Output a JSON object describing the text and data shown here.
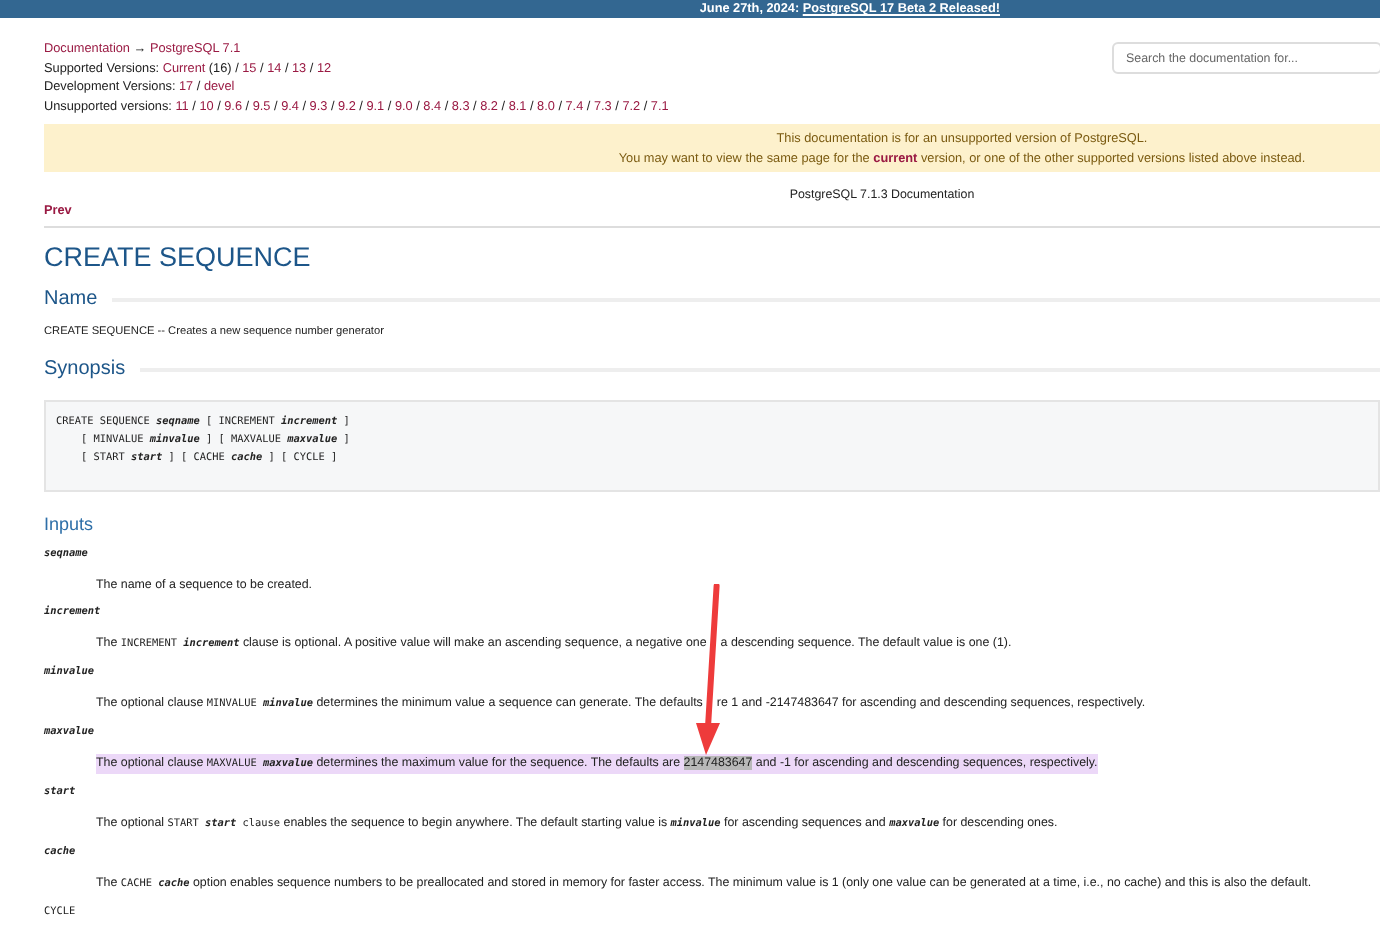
{
  "banner": [
    {
      "kind": "text",
      "text": "June 27th, 2024: "
    },
    {
      "kind": "link",
      "text": "PostgreSQL 17 Beta 2 Released!"
    }
  ],
  "search": {
    "placeholder": "Search the documentation for..."
  },
  "version_lines": [
    [
      {
        "kind": "link",
        "text": "Documentation"
      },
      {
        "kind": "text",
        "text": " → "
      },
      {
        "kind": "link",
        "text": "PostgreSQL 7.1"
      }
    ],
    [
      {
        "kind": "text",
        "text": "Supported Versions: "
      },
      {
        "kind": "link",
        "text": "Current"
      },
      {
        "kind": "text",
        "text": " (16) / "
      },
      {
        "kind": "link",
        "text": "15"
      },
      {
        "kind": "text",
        "text": " / "
      },
      {
        "kind": "link",
        "text": "14"
      },
      {
        "kind": "text",
        "text": " / "
      },
      {
        "kind": "link",
        "text": "13"
      },
      {
        "kind": "text",
        "text": " / "
      },
      {
        "kind": "link",
        "text": "12"
      }
    ],
    [
      {
        "kind": "text",
        "text": "Development Versions: "
      },
      {
        "kind": "link",
        "text": "17"
      },
      {
        "kind": "text",
        "text": " / "
      },
      {
        "kind": "link",
        "text": "devel"
      }
    ],
    [
      {
        "kind": "text",
        "text": "Unsupported versions: "
      },
      {
        "kind": "link",
        "text": "11"
      },
      {
        "kind": "text",
        "text": " / "
      },
      {
        "kind": "link",
        "text": "10"
      },
      {
        "kind": "text",
        "text": " / "
      },
      {
        "kind": "link",
        "text": "9.6"
      },
      {
        "kind": "text",
        "text": " / "
      },
      {
        "kind": "link",
        "text": "9.5"
      },
      {
        "kind": "text",
        "text": " / "
      },
      {
        "kind": "link",
        "text": "9.4"
      },
      {
        "kind": "text",
        "text": " / "
      },
      {
        "kind": "link",
        "text": "9.3"
      },
      {
        "kind": "text",
        "text": " / "
      },
      {
        "kind": "link",
        "text": "9.2"
      },
      {
        "kind": "text",
        "text": " / "
      },
      {
        "kind": "link",
        "text": "9.1"
      },
      {
        "kind": "text",
        "text": " / "
      },
      {
        "kind": "link",
        "text": "9.0"
      },
      {
        "kind": "text",
        "text": " / "
      },
      {
        "kind": "link",
        "text": "8.4"
      },
      {
        "kind": "text",
        "text": " / "
      },
      {
        "kind": "link",
        "text": "8.3"
      },
      {
        "kind": "text",
        "text": " / "
      },
      {
        "kind": "link",
        "text": "8.2"
      },
      {
        "kind": "text",
        "text": " / "
      },
      {
        "kind": "link",
        "text": "8.1"
      },
      {
        "kind": "text",
        "text": " / "
      },
      {
        "kind": "link",
        "text": "8.0"
      },
      {
        "kind": "text",
        "text": " / "
      },
      {
        "kind": "link",
        "text": "7.4"
      },
      {
        "kind": "text",
        "text": " / "
      },
      {
        "kind": "link",
        "text": "7.3"
      },
      {
        "kind": "text",
        "text": " / "
      },
      {
        "kind": "link",
        "text": "7.2"
      },
      {
        "kind": "text",
        "text": " / "
      },
      {
        "kind": "link",
        "text": "7.1"
      }
    ]
  ],
  "notice": [
    [
      {
        "kind": "text",
        "text": "This documentation is for an unsupported version of PostgreSQL."
      }
    ],
    [
      {
        "kind": "text",
        "text": "You may want to view the same page for the "
      },
      {
        "kind": "strong_link",
        "text": "current"
      },
      {
        "kind": "text",
        "text": " version, or one of the other supported versions listed above instead."
      }
    ]
  ],
  "nav_header": {
    "title": "PostgreSQL 7.1.3 Documentation",
    "prev": "Prev"
  },
  "title": "CREATE SEQUENCE",
  "name_section": {
    "heading": "Name",
    "text": "CREATE SEQUENCE  --  Creates a new sequence number generator"
  },
  "synopsis": {
    "heading": "Synopsis",
    "lines": [
      [
        {
          "kind": "code",
          "text": "CREATE SEQUENCE "
        },
        {
          "kind": "param",
          "text": "seqname"
        },
        {
          "kind": "code",
          "text": " [ INCREMENT "
        },
        {
          "kind": "param",
          "text": "increment"
        },
        {
          "kind": "code",
          "text": " ]"
        }
      ],
      [
        {
          "kind": "code",
          "text": "    [ MINVALUE "
        },
        {
          "kind": "param",
          "text": "minvalue"
        },
        {
          "kind": "code",
          "text": " ] [ MAXVALUE "
        },
        {
          "kind": "param",
          "text": "maxvalue"
        },
        {
          "kind": "code",
          "text": " ]"
        }
      ],
      [
        {
          "kind": "code",
          "text": "    [ START "
        },
        {
          "kind": "param",
          "text": "start"
        },
        {
          "kind": "code",
          "text": " ] [ CACHE "
        },
        {
          "kind": "param",
          "text": "cache"
        },
        {
          "kind": "code",
          "text": " ] [ CYCLE ]"
        }
      ]
    ]
  },
  "inputs": {
    "heading": "Inputs",
    "entries": [
      {
        "term": {
          "kind": "param",
          "text": "seqname"
        },
        "highlighted": false,
        "description": [
          {
            "kind": "text",
            "text": "The name of a sequence to be created."
          }
        ]
      },
      {
        "term": {
          "kind": "param",
          "text": "increment"
        },
        "highlighted": false,
        "description": [
          {
            "kind": "text",
            "text": "The "
          },
          {
            "kind": "code",
            "text": "INCREMENT "
          },
          {
            "kind": "param",
            "text": "increment"
          },
          {
            "kind": "text",
            "text": " clause is optional. A positive value will make an ascending sequence, a negative one"
          },
          {
            "kind": "arrow_gap"
          },
          {
            "kind": "text",
            "text": "a descending sequence. The default value is one (1)."
          }
        ]
      },
      {
        "term": {
          "kind": "param",
          "text": "minvalue"
        },
        "highlighted": false,
        "description": [
          {
            "kind": "text",
            "text": "The optional clause "
          },
          {
            "kind": "code",
            "text": "MINVALUE "
          },
          {
            "kind": "param",
            "text": "minvalue"
          },
          {
            "kind": "text",
            "text": " determines the minimum value a sequence can generate. The defaults"
          },
          {
            "kind": "arrow_gap"
          },
          {
            "kind": "text",
            "text": "re 1 and -2147483647 for ascending and descending sequences, respectively."
          }
        ]
      },
      {
        "term": {
          "kind": "param",
          "text": "maxvalue"
        },
        "highlighted": true,
        "description": [
          {
            "kind": "text",
            "text": "The optional clause "
          },
          {
            "kind": "code",
            "text": "MAXVALUE "
          },
          {
            "kind": "param",
            "text": "maxvalue"
          },
          {
            "kind": "text",
            "text": " determines the maximum value for the sequence. The defaults are "
          },
          {
            "kind": "selected",
            "text": "2147483647"
          },
          {
            "kind": "text",
            "text": " and -1 for ascending and descending sequences, respectively."
          }
        ]
      },
      {
        "term": {
          "kind": "param",
          "text": "start"
        },
        "highlighted": false,
        "description": [
          {
            "kind": "text",
            "text": "The optional "
          },
          {
            "kind": "code",
            "text": "START "
          },
          {
            "kind": "param",
            "text": "start"
          },
          {
            "kind": "code",
            "text": " clause"
          },
          {
            "kind": "text",
            "text": " enables the sequence to begin anywhere. The default starting value is "
          },
          {
            "kind": "param",
            "text": "minvalue"
          },
          {
            "kind": "text",
            "text": " for ascending sequences and "
          },
          {
            "kind": "param",
            "text": "maxvalue"
          },
          {
            "kind": "text",
            "text": " for descending ones."
          }
        ]
      },
      {
        "term": {
          "kind": "param",
          "text": "cache"
        },
        "highlighted": false,
        "description": [
          {
            "kind": "text",
            "text": "The "
          },
          {
            "kind": "code",
            "text": "CACHE "
          },
          {
            "kind": "param",
            "text": "cache"
          },
          {
            "kind": "text",
            "text": " option enables sequence numbers to be preallocated and stored in memory for faster access. The minimum value is 1 (only one value can be generated at a time, i.e., no cache) and this is also the default."
          }
        ]
      },
      {
        "term": {
          "kind": "code",
          "text": "CYCLE"
        },
        "highlighted": false
      }
    ]
  }
}
